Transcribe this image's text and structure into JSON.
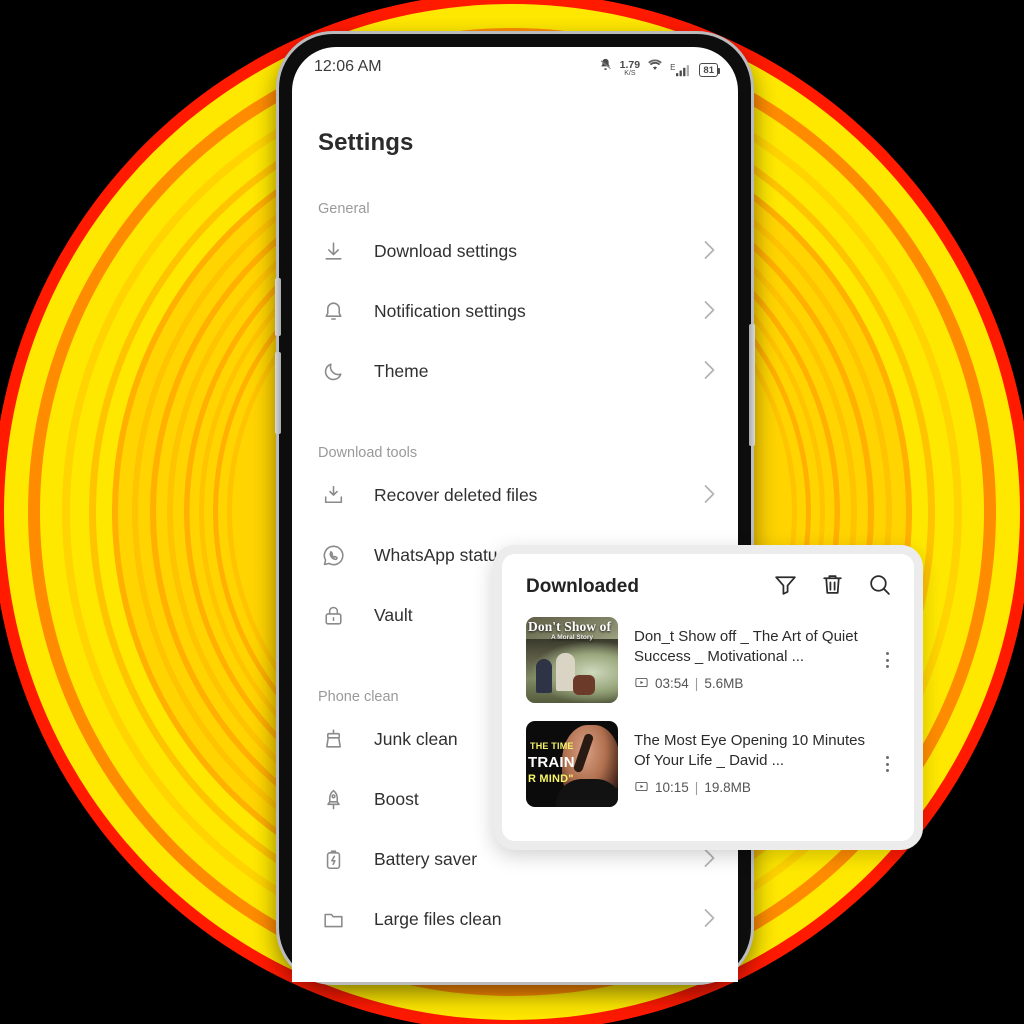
{
  "background": {
    "canvas_color": "#000000",
    "ring_colors": [
      "#ff1a00",
      "#ffe800",
      "#ff8c00",
      "#ffd400",
      "#ffc400",
      "#ffb000"
    ]
  },
  "phone": {
    "status_bar": {
      "time": "12:06 AM",
      "mute_icon": "bell-slash-icon",
      "network_speed_value": "1.79",
      "network_speed_unit": "K/S",
      "wifi_icon": "wifi-icon",
      "signal_type": "E",
      "signal_icon": "signal-bars-icon",
      "battery_level": "81"
    },
    "buttons": {
      "volume_up": "volume-up-button",
      "volume_down": "volume-down-button",
      "power": "power-button"
    }
  },
  "settings": {
    "title": "Settings",
    "sections": [
      {
        "label": "General",
        "items": [
          {
            "icon": "download-icon",
            "label": "Download settings",
            "chevron": true
          },
          {
            "icon": "bell-icon",
            "label": "Notification settings",
            "chevron": true
          },
          {
            "icon": "moon-icon",
            "label": "Theme",
            "chevron": true
          }
        ]
      },
      {
        "label": "Download tools",
        "items": [
          {
            "icon": "recover-file-icon",
            "label": "Recover deleted files",
            "chevron": true
          },
          {
            "icon": "whatsapp-icon",
            "label": "WhatsApp status s",
            "chevron": false
          },
          {
            "icon": "lock-icon",
            "label": "Vault",
            "chevron": false
          }
        ]
      },
      {
        "label": "Phone clean",
        "items": [
          {
            "icon": "broom-icon",
            "label": "Junk clean",
            "chevron": false
          },
          {
            "icon": "rocket-icon",
            "label": "Boost",
            "chevron": false
          },
          {
            "icon": "battery-bolt-icon",
            "label": "Battery saver",
            "chevron": true
          },
          {
            "icon": "folder-icon",
            "label": "Large files clean",
            "chevron": true
          }
        ]
      }
    ]
  },
  "downloaded_card": {
    "title": "Downloaded",
    "actions": [
      {
        "icon": "filter-icon",
        "name": "filter-button"
      },
      {
        "icon": "trash-icon",
        "name": "delete-button"
      },
      {
        "icon": "search-icon",
        "name": "search-button"
      }
    ],
    "items": [
      {
        "title": "Don_t Show off _ The Art of Quiet Success _ Motivational ...",
        "duration": "03:54",
        "separator": "|",
        "size": "5.6MB",
        "thumbnail_title": "Don't Show of",
        "thumbnail_subtitle": "A Moral Story",
        "menu": "more-options-button"
      },
      {
        "title": "The Most Eye Opening 10 Minutes Of Your Life _ David ...",
        "duration": "10:15",
        "separator": "|",
        "size": "19.8MB",
        "thumbnail_line1": "THE TIME",
        "thumbnail_line2": "TRAIN",
        "thumbnail_line3": "R MIND\"",
        "menu": "more-options-button"
      }
    ]
  }
}
